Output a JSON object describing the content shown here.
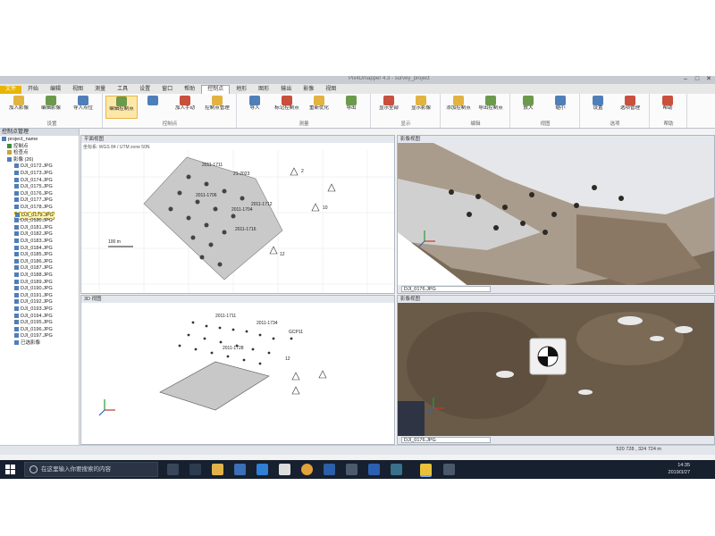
{
  "window": {
    "title": "Pix4Dmapper 4.3 - survey_project"
  },
  "tabs": [
    "文件",
    "开始",
    "编辑",
    "视图",
    "测量",
    "工具",
    "设置",
    "窗口",
    "帮助",
    "控制点",
    "地形",
    "图形",
    "输出",
    "影像",
    "视图"
  ],
  "active_tab_index": 9,
  "ribbon": {
    "groups": [
      {
        "label": "设置",
        "buttons": [
          "加入影像",
          "编辑影像",
          "导入点位"
        ]
      },
      {
        "label": "控制点",
        "buttons": [
          "编辑控制点",
          "",
          "加入手动",
          "控制点管理"
        ]
      },
      {
        "label": "测量",
        "buttons": [
          "导入",
          "标记控制点",
          "重新优化",
          "导出"
        ]
      },
      {
        "label": "显示",
        "buttons": [
          "显示全部",
          "显示影像"
        ]
      },
      {
        "label": "编辑",
        "buttons": [
          "添加控制点",
          "导出控制点"
        ]
      },
      {
        "label": "视图",
        "buttons": [
          "放大",
          "缩小"
        ]
      },
      {
        "label": "选项",
        "buttons": [
          "设置",
          "选项管理"
        ]
      },
      {
        "label": "帮助",
        "buttons": [
          "帮助"
        ]
      }
    ]
  },
  "left_panel": {
    "header": "控制点管理",
    "rows": [
      "project_name",
      "控制点",
      "检查点",
      "影像 (26)",
      "DJI_0172.JPG",
      "DJI_0173.JPG",
      "DJI_0174.JPG",
      "DJI_0175.JPG",
      "DJI_0176.JPG",
      "DJI_0177.JPG",
      "DJI_0178.JPG",
      "DJI_0179.JPG",
      "DJI_0180.JPG",
      "DJI_0181.JPG",
      "DJI_0182.JPG",
      "DJI_0183.JPG",
      "DJI_0184.JPG",
      "DJI_0185.JPG",
      "DJI_0186.JPG",
      "DJI_0187.JPG",
      "DJI_0188.JPG",
      "DJI_0189.JPG",
      "DJI_0190.JPG",
      "DJI_0191.JPG",
      "DJI_0192.JPG",
      "DJI_0193.JPG",
      "DJI_0194.JPG",
      "DJI_0195.JPG",
      "DJI_0196.JPG",
      "DJI_0197.JPG",
      "已选影像"
    ],
    "selected_index": 11
  },
  "views": {
    "top_left_title": "平面视图",
    "top_left_header_text": "坐标系: WGS 84 / UTM zone 50N",
    "bottom_left_title": "3D 视图",
    "top_right_title": "影像视图",
    "bottom_right_title": "影像视图",
    "top_right_dropdown": "DJI_0176.JPG",
    "bottom_right_dropdown": "DJI_0176.JPG",
    "bottom_left_dropdown": "",
    "gcp_labels": [
      "2011-1711",
      "21-2023",
      "2",
      "2011-1706",
      "2011-1704",
      "2011-1712",
      "2011-1734",
      "2011-1716",
      "GCP11",
      "2011-1728",
      "12",
      "10"
    ],
    "scale_label": "100 m"
  },
  "status": {
    "coords": "520 728 , 324 724 m"
  },
  "taskbar": {
    "search_placeholder": "在这里输入你要搜索的内容",
    "time": "14:35",
    "date": "2019/3/27"
  }
}
